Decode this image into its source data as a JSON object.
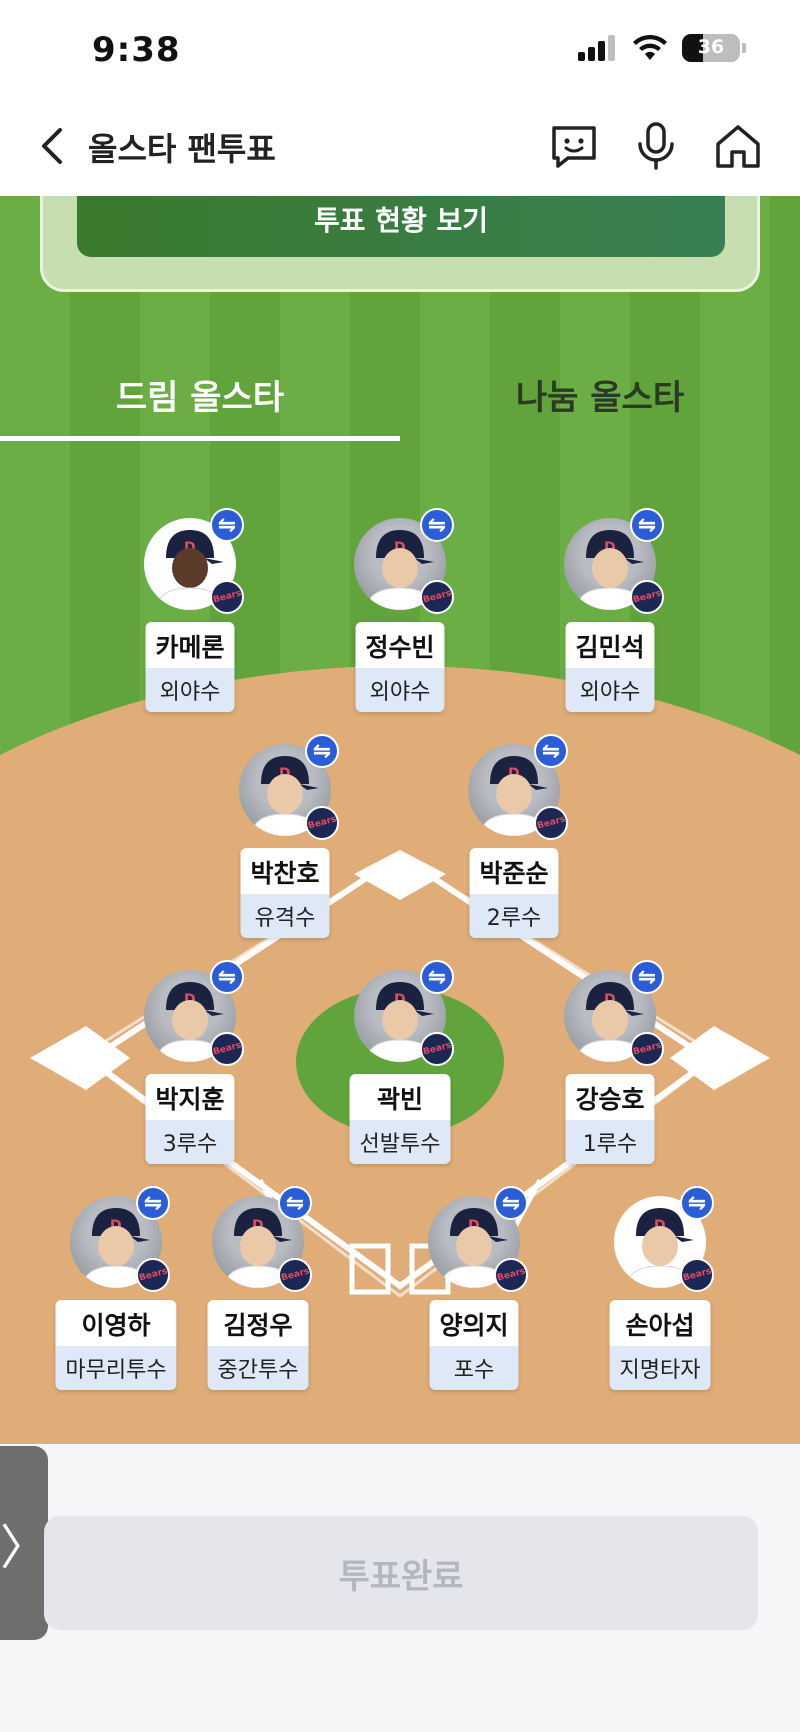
{
  "status": {
    "time": "9:38",
    "battery": "36",
    "battery_level": 0.36
  },
  "nav": {
    "title": "올스타 팬투표"
  },
  "vote_status_button": "투표 현황 보기",
  "tabs": [
    {
      "label": "드림 올스타",
      "active": true
    },
    {
      "label": "나눔 올스타",
      "active": false
    }
  ],
  "players": [
    {
      "name": "카메론",
      "position": "외야수"
    },
    {
      "name": "정수빈",
      "position": "외야수"
    },
    {
      "name": "김민석",
      "position": "외야수"
    },
    {
      "name": "박찬호",
      "position": "유격수"
    },
    {
      "name": "박준순",
      "position": "2루수"
    },
    {
      "name": "박지훈",
      "position": "3루수"
    },
    {
      "name": "곽빈",
      "position": "선발투수"
    },
    {
      "name": "강승호",
      "position": "1루수"
    },
    {
      "name": "이영하",
      "position": "마무리투수"
    },
    {
      "name": "김정우",
      "position": "중간투수"
    },
    {
      "name": "양의지",
      "position": "포수"
    },
    {
      "name": "손아섭",
      "position": "지명타자"
    }
  ],
  "swap_icon": "⇋",
  "side_tab_icon": "〉",
  "complete_button": "투표완료",
  "colors": {
    "field_green": "#6aae45",
    "infield": "#e2b27e",
    "swap_blue": "#2b5ed6",
    "vote_button": "#3a7a2c"
  }
}
